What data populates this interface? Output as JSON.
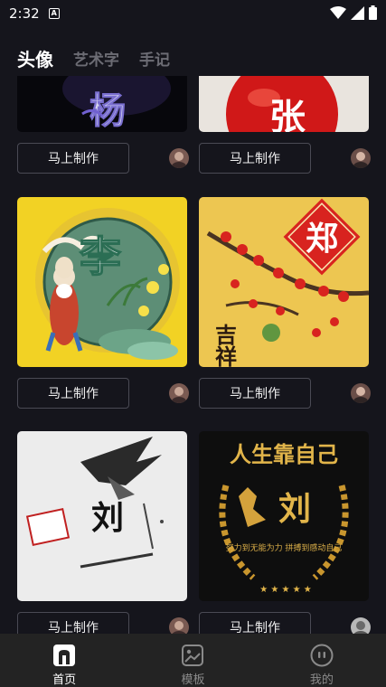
{
  "status_bar": {
    "time": "2:32",
    "app_icon": "A"
  },
  "top_tabs": [
    {
      "label": "头像",
      "active": true
    },
    {
      "label": "艺术字",
      "active": false
    },
    {
      "label": "手记",
      "active": false
    }
  ],
  "cards": [
    {
      "surname": "杨",
      "button": "马上制作",
      "icons": {
        "image": "avatar-image-yang",
        "author": "author-avatar"
      }
    },
    {
      "surname": "张",
      "button": "马上制作",
      "icons": {
        "image": "avatar-image-zhang",
        "author": "author-avatar"
      }
    },
    {
      "surname": "李",
      "button": "马上制作",
      "icons": {
        "image": "avatar-image-li",
        "author": "author-avatar"
      }
    },
    {
      "surname": "郑",
      "button": "马上制作",
      "caption": "吉祥",
      "icons": {
        "image": "avatar-image-zheng",
        "author": "author-avatar"
      }
    },
    {
      "surname": "刘",
      "button": "马上制作",
      "icons": {
        "image": "avatar-image-liu-eagle",
        "author": "author-avatar"
      }
    },
    {
      "surname": "刘",
      "button": "马上制作",
      "banner": "人生靠自己",
      "motto": "努力到无能为力 拼搏到感动自己",
      "icons": {
        "image": "avatar-image-liu-gold",
        "author": "author-avatar"
      }
    }
  ],
  "bottom_nav": [
    {
      "label": "首页",
      "icon": "home-icon",
      "active": true
    },
    {
      "label": "模板",
      "icon": "template-icon",
      "active": false
    },
    {
      "label": "我的",
      "icon": "profile-icon",
      "active": false
    }
  ],
  "colors": {
    "background": "#15151c",
    "nav_background": "#232323",
    "button_border": "#4a4a54"
  }
}
